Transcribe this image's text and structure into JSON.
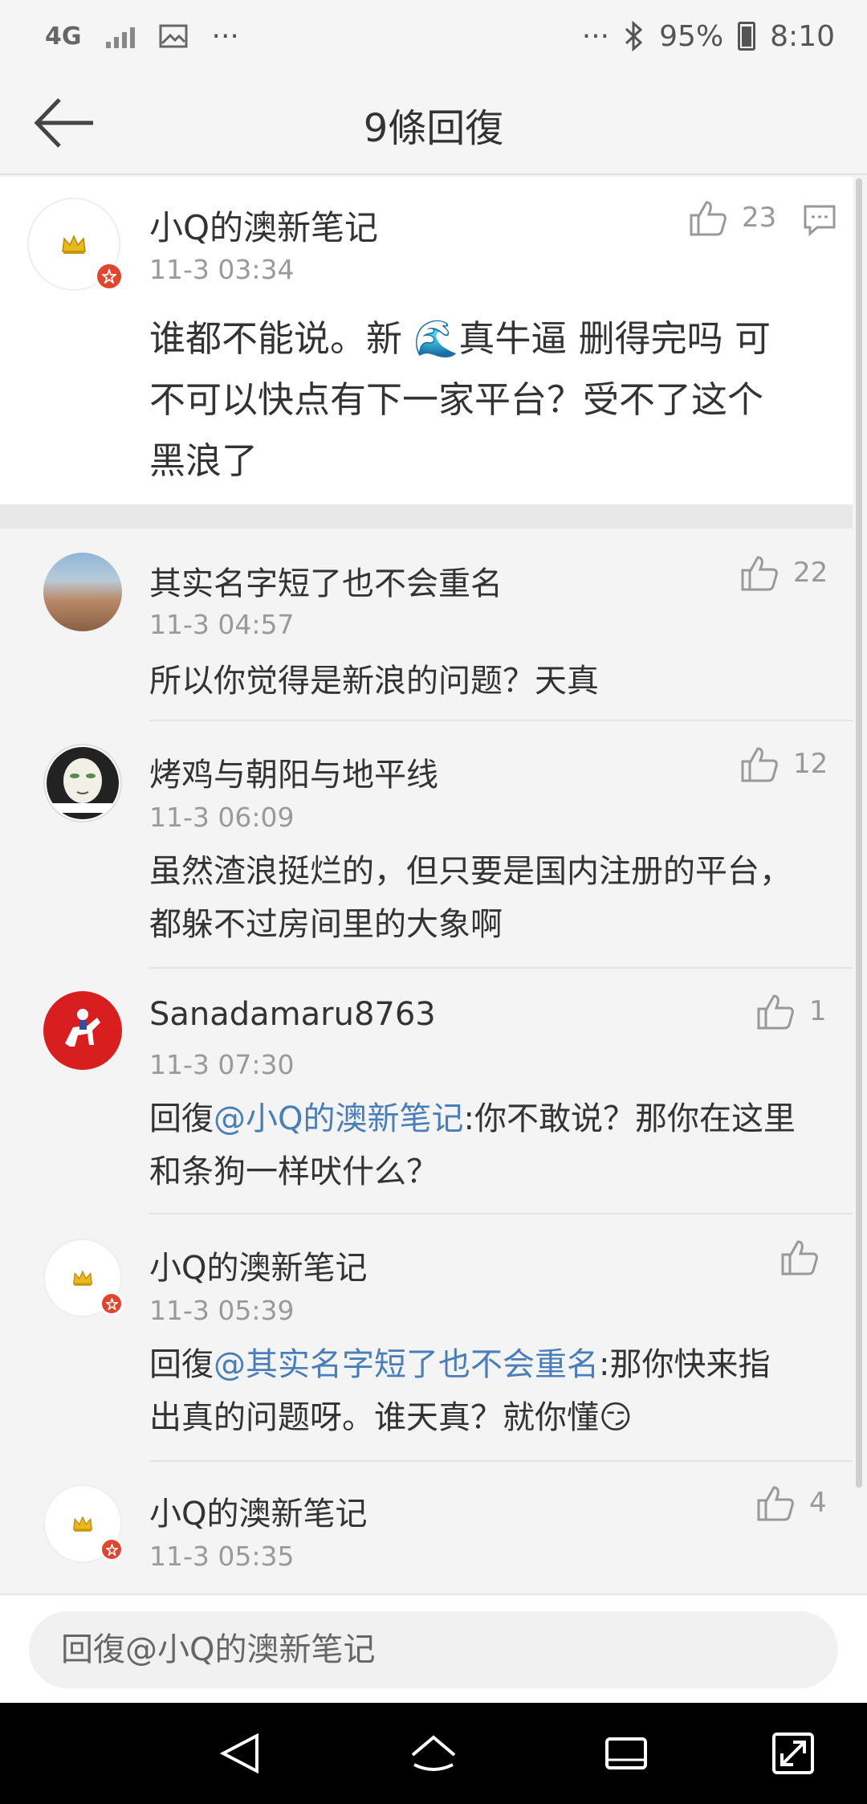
{
  "status_bar": {
    "network": "4G",
    "overflow": "···",
    "overflow_right": "···",
    "battery": "95%",
    "time": "8:10"
  },
  "header": {
    "title": "9條回復"
  },
  "main_comment": {
    "author": "小Q的澳新笔记",
    "time": "11-3 03:34",
    "likes": "23",
    "text_lines": [
      "谁都不能说。新 🌊真牛逼 删得完吗 可",
      "不可以快点有下一家平台？受不了这个",
      "黑浪了"
    ]
  },
  "replies": [
    {
      "author": "其实名字短了也不会重名",
      "time": "11-3 04:57",
      "likes": "22",
      "text": "所以你觉得是新浪的问题？天真"
    },
    {
      "author": "烤鸡与朝阳与地平线",
      "time": "11-3 06:09",
      "likes": "12",
      "text_lines": [
        "虽然渣浪挺烂的，但只要是国内注册的平台，",
        "都躲不过房间里的大象啊"
      ]
    },
    {
      "author": "Sanadamaru8763",
      "time": "11-3 07:30",
      "likes": "1",
      "prefix": "回復",
      "mention": "@小Q的澳新笔记",
      "line1_rest": ":你不敢说？那你在这里",
      "line2": "和条狗一样吠什么？"
    },
    {
      "author": "小Q的澳新笔记",
      "time": "11-3 05:39",
      "likes": "",
      "prefix": "回復",
      "mention": "@其实名字短了也不会重名",
      "line1_rest": ":那你快来指",
      "line2": "出真的问题呀。谁天真？就你懂😏"
    },
    {
      "author": "小Q的澳新笔记",
      "time": "11-3 05:35",
      "likes": "4"
    }
  ],
  "input": {
    "placeholder": "回復@小Q的澳新笔记"
  },
  "colors": {
    "mention": "#4a7eb8",
    "badge": "#e0452e",
    "muted": "#9a9a9a"
  }
}
